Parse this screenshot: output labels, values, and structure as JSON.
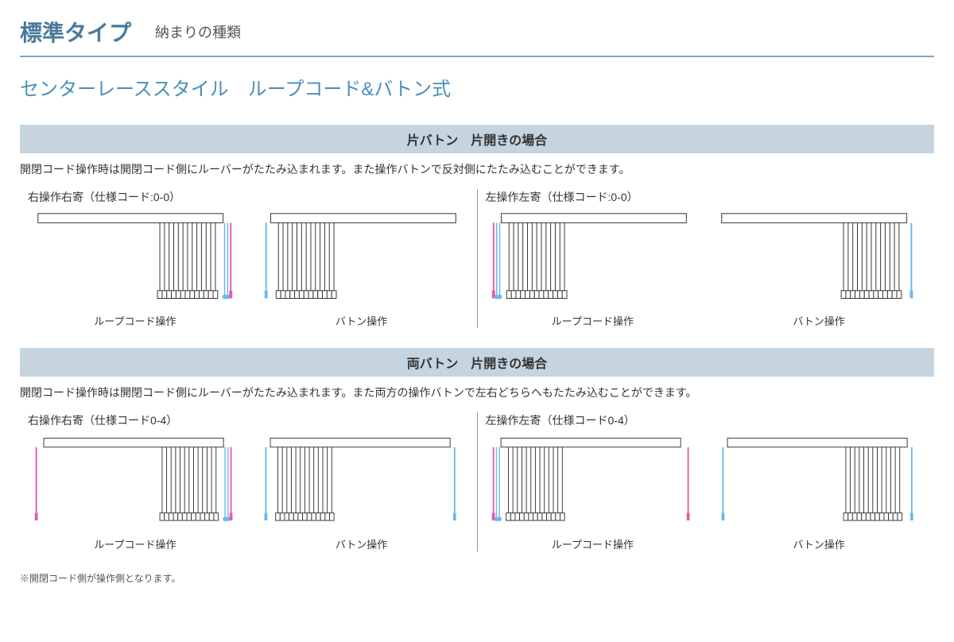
{
  "header": {
    "main": "標準タイプ",
    "sub": "納まりの種類"
  },
  "style_title": "センターレーススタイル　ループコード&バトン式",
  "sections": [
    {
      "bar": "片バトン　片開きの場合",
      "desc": "開閉コード操作時は開閉コード側にルーバーがたたみ込まれます。また操作バトンで反対側にたたみ込むことができます。",
      "left_spec": "右操作右寄（仕様コード:0-0）",
      "right_spec": "左操作左寄（仕様コード:0-0）",
      "op_labels": {
        "loop": "ループコード操作",
        "baton": "バトン操作"
      }
    },
    {
      "bar": "両バトン　片開きの場合",
      "desc": "開閉コード操作時は開閉コード側にルーバーがたたみ込まれます。また両方の操作バトンで左右どちらへもたたみ込むことができます。",
      "left_spec": "右操作右寄（仕様コード0-4）",
      "right_spec": "左操作左寄（仕様コード0-4）",
      "op_labels": {
        "loop": "ループコード操作",
        "baton": "バトン操作"
      }
    }
  ],
  "footnote": "※開閉コード側が操作側となります。"
}
